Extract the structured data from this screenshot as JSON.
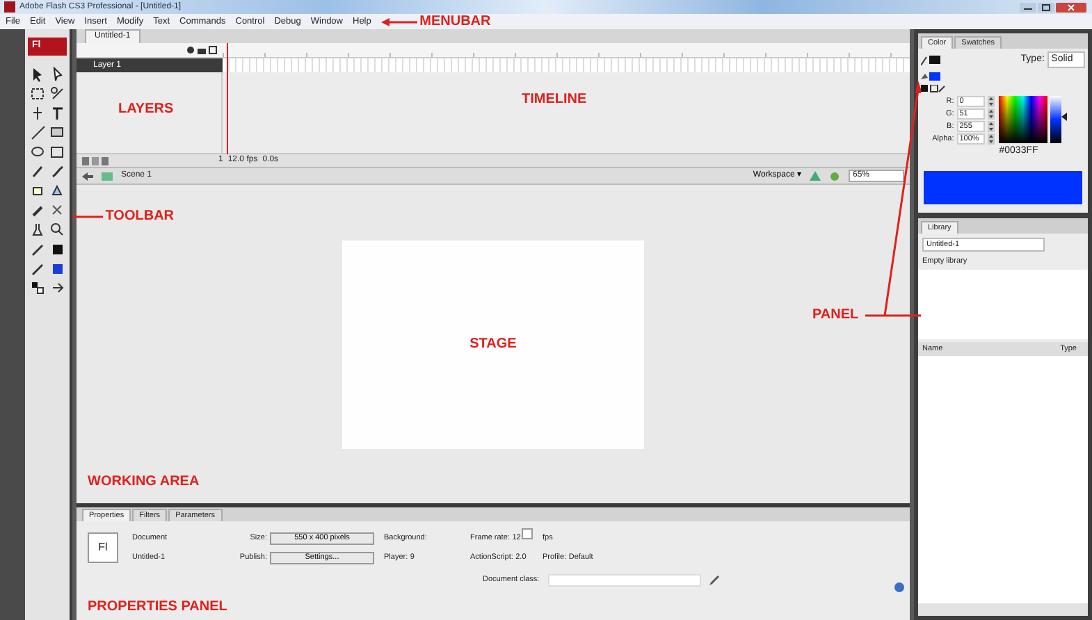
{
  "window": {
    "title": "Adobe Flash CS3 Professional - [Untitled-1]"
  },
  "menubar": {
    "items": [
      "File",
      "Edit",
      "View",
      "Insert",
      "Modify",
      "Text",
      "Commands",
      "Control",
      "Debug",
      "Window",
      "Help"
    ],
    "annotation": "MENUBAR"
  },
  "toolbar": {
    "logo": "Fl",
    "annotation": "TOOLBAR"
  },
  "timeline": {
    "tab": "Untitled-1",
    "layers": [
      {
        "name": "Layer 1",
        "selected": true
      }
    ],
    "frame": "1",
    "frame_rate": "12.0 fps",
    "time": "0.0s",
    "layers_annotation": "LAYERS",
    "annotation": "TIMELINE"
  },
  "edit_bar": {
    "scene": "Scene 1",
    "workspace": "Workspace ▾",
    "zoom": "65%"
  },
  "stage": {
    "annotation": "STAGE",
    "area_annotation": "WORKING AREA"
  },
  "properties": {
    "tabs": [
      {
        "label": "Properties",
        "selected": true
      },
      {
        "label": "Filters",
        "selected": false
      },
      {
        "label": "Parameters",
        "selected": false
      }
    ],
    "logo": "Fl",
    "doc_type": "Document",
    "doc_name": "Untitled-1",
    "size_label": "Size:",
    "size": "550 x 400 pixels",
    "publish_label": "Publish:",
    "publish": "Settings...",
    "background_label": "Background:",
    "frame_rate_label": "Frame rate:",
    "frame_rate": "12",
    "fps": "fps",
    "player_label": "Player:",
    "player": "9",
    "as_label": "ActionScript:",
    "as": "2.0",
    "profile_label": "Profile:",
    "profile": "Default",
    "class_label": "Document class:",
    "annotation": "PROPERTIES PANEL"
  },
  "color_panel": {
    "tabs": [
      {
        "label": "Color",
        "selected": true
      },
      {
        "label": "Swatches",
        "selected": false
      }
    ],
    "type_label": "Type:",
    "type": "Solid",
    "fields": [
      {
        "label": "R:",
        "value": "0"
      },
      {
        "label": "G:",
        "value": "51"
      },
      {
        "label": "B:",
        "value": "255"
      },
      {
        "label": "Alpha:",
        "value": "100%"
      }
    ],
    "hex": "#0033FF",
    "color": "#0033ff",
    "brightness_slider": {
      "level": 0.55
    }
  },
  "library": {
    "tabs": [
      {
        "label": "Library",
        "selected": true
      }
    ],
    "document": "Untitled-1",
    "status": "Empty library",
    "columns": [
      "Name",
      "Type"
    ]
  },
  "panel_annotation": "PANEL"
}
